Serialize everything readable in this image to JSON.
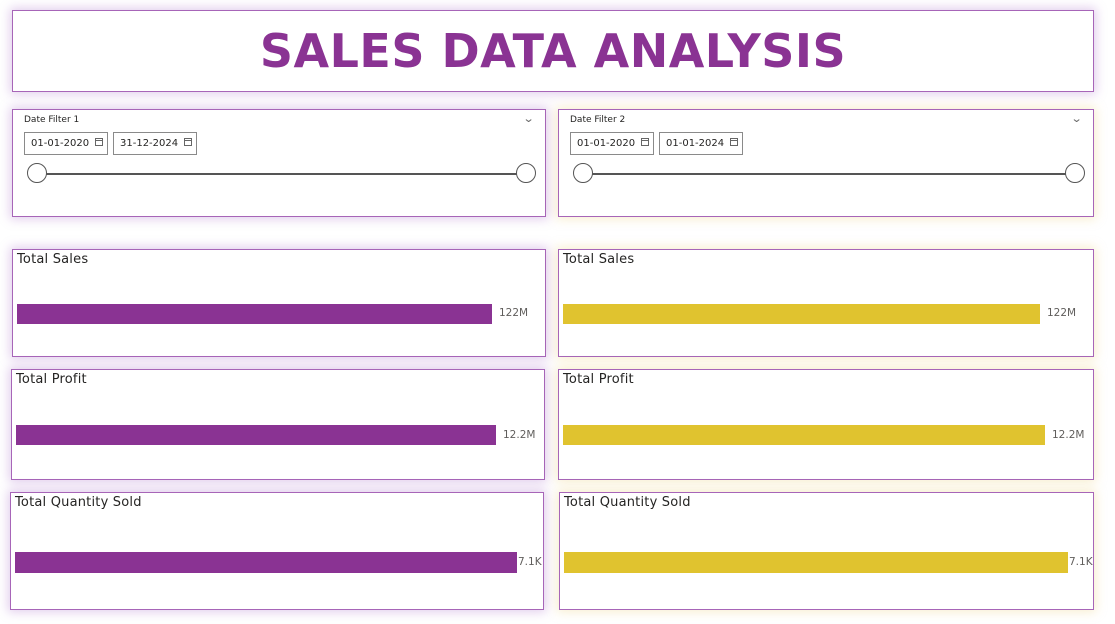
{
  "title": "SALES DATA ANALYSIS",
  "colors": {
    "title": "#8a3393",
    "series_1": "#8a3393",
    "series_2": "#e0c32f",
    "border": "#a765b8"
  },
  "filters": [
    {
      "label": "Date Filter 1",
      "start": "01-01-2020",
      "end": "31-12-2024",
      "range_fraction": [
        0,
        1
      ]
    },
    {
      "label": "Date Filter 2",
      "start": "01-01-2020",
      "end": "01-01-2024",
      "range_fraction": [
        0,
        1
      ]
    }
  ],
  "kpis": {
    "left": [
      {
        "title": "Total Sales",
        "value_label": "122M",
        "fill_fraction": 1
      },
      {
        "title": "Total Profit",
        "value_label": "12.2M",
        "fill_fraction": 1
      },
      {
        "title": "Total Quantity Sold",
        "value_label": "7.1K",
        "fill_fraction": 1
      }
    ],
    "right": [
      {
        "title": "Total Sales",
        "value_label": "122M",
        "fill_fraction": 1
      },
      {
        "title": "Total Profit",
        "value_label": "12.2M",
        "fill_fraction": 1
      },
      {
        "title": "Total Quantity Sold",
        "value_label": "7.1K",
        "fill_fraction": 1
      }
    ]
  },
  "icons": {
    "dropdown": "chevron-down-icon",
    "calendar": "calendar-icon"
  }
}
